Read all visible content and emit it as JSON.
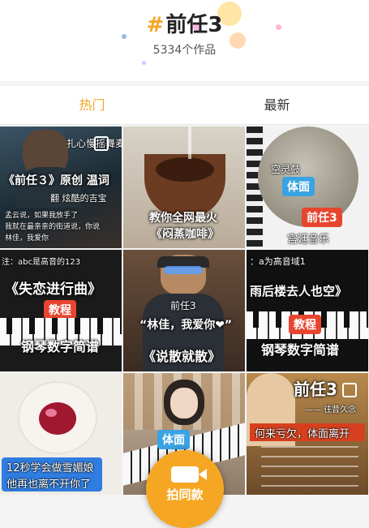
{
  "header": {
    "hash": "#",
    "title": "前任3",
    "count": "5334个作品"
  },
  "tabs": {
    "hot": "热门",
    "latest": "最新"
  },
  "record": {
    "label": "拍同款"
  },
  "colors": {
    "accent": "#f5a623"
  },
  "cells": {
    "c1": {
      "top_caption": "扎心慢摇舞麦",
      "main": "《前任３》原创 温词",
      "sub": "翻 炫酷的吉宝",
      "line1": "孟云说，如果我放手了",
      "line2": "我就在最亲亲的街道说，你说",
      "line3": "林佳，我爱你"
    },
    "c2": {
      "line1": "教你全网最火",
      "line2": "《闷蒸咖啡》"
    },
    "c3": {
      "line1": "空灵鼓",
      "tag": "体面",
      "tag2": "前任3",
      "line2": "宫廷音乐"
    },
    "c4": {
      "top_caption": "注：abc是高音的123",
      "main": "《失恋进行曲》",
      "tag": "教程",
      "sub": "钢琴数字简谱"
    },
    "c5": {
      "tag": "前任3",
      "line1": "“林佳，我爱你❤”",
      "line2": "《说散就散》"
    },
    "c6": {
      "top_caption": "：a为高音域1",
      "main": "雨后楼去人也空》",
      "tag": "教程",
      "sub": "钢琴数字简谱"
    },
    "c7": {
      "line1": "12秒学会做雪媚娘",
      "line2": "他再也离不开你了"
    },
    "c8": {
      "tag": "体面"
    },
    "c9": {
      "title": "前任3",
      "sub": "—— 往昔久念",
      "banner": "何来亏欠，体面离开"
    }
  }
}
